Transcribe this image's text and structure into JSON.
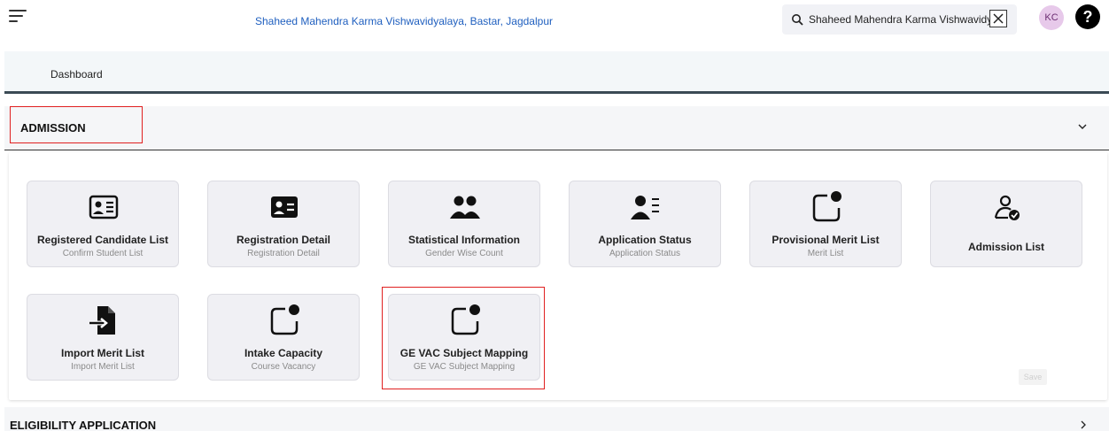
{
  "header": {
    "title": "Shaheed Mahendra Karma Vishwavidyalaya, Bastar, Jagdalpur",
    "search_value": "Shaheed Mahendra Karma Vishwavidyalaya, Bastar, Jagdalpur",
    "avatar_initials": "KC",
    "help_symbol": "?"
  },
  "breadcrumb": {
    "label": "Dashboard"
  },
  "sections": {
    "admission": {
      "title": "ADMISSION"
    },
    "eligibility": {
      "title": "ELIGIBILITY APPLICATION"
    }
  },
  "tiles": [
    {
      "title": "Registered Candidate List",
      "subtitle": "Confirm Student List",
      "icon": "id-card-icon"
    },
    {
      "title": "Registration Detail",
      "subtitle": "Registration Detail",
      "icon": "id-card-filled-icon"
    },
    {
      "title": "Statistical Information",
      "subtitle": "Gender Wise Count",
      "icon": "users-icon"
    },
    {
      "title": "Application Status",
      "subtitle": "Application Status",
      "icon": "user-list-icon"
    },
    {
      "title": "Provisional Merit List",
      "subtitle": "Merit List",
      "icon": "notification-square-icon"
    },
    {
      "title": "Admission List",
      "subtitle": "",
      "icon": "user-check-icon"
    },
    {
      "title": "Import Merit List",
      "subtitle": "Import Merit List",
      "icon": "file-import-icon"
    },
    {
      "title": "Intake Capacity",
      "subtitle": "Course Vacancy",
      "icon": "notification-square-icon"
    },
    {
      "title": "GE VAC Subject Mapping",
      "subtitle": "GE VAC Subject Mapping",
      "icon": "notification-square-icon"
    }
  ],
  "save_label": "Save",
  "colors": {
    "header_link": "#1f5fbf",
    "highlight": "#e02020",
    "avatar_bg": "#e7c9ea"
  }
}
